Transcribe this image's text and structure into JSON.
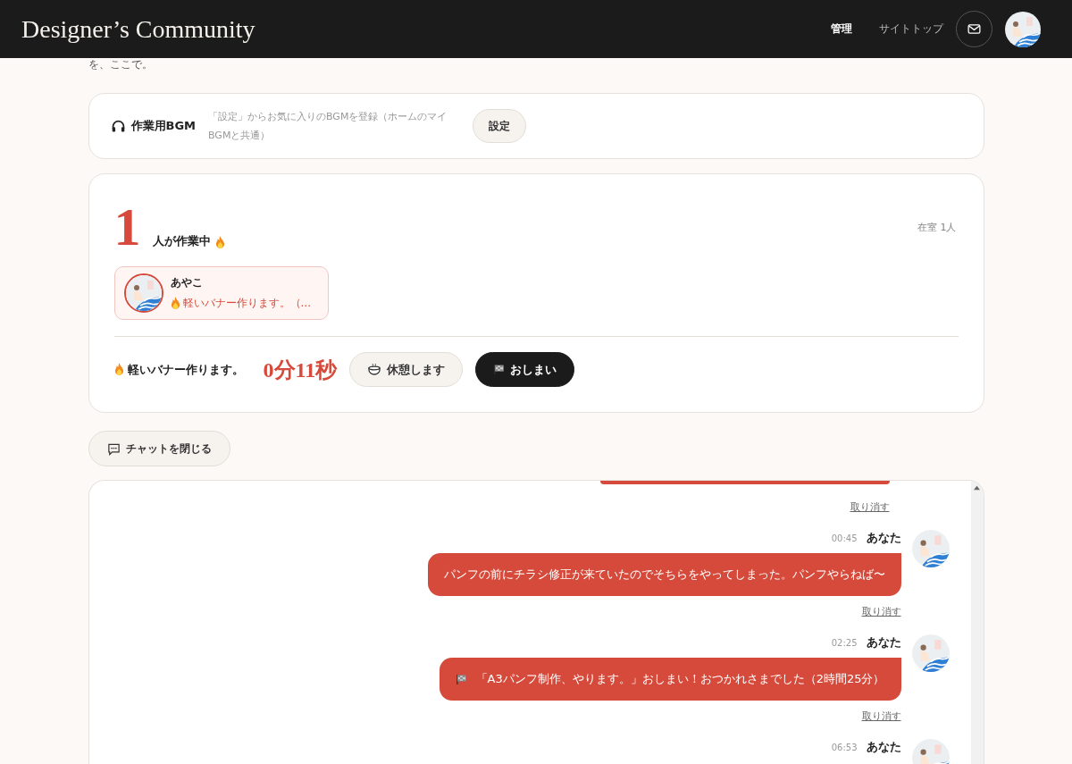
{
  "header": {
    "title": "Designer’s Community",
    "nav": [
      {
        "label": "管理",
        "selected": true
      },
      {
        "label": "サイトトップ",
        "selected": false
      }
    ]
  },
  "intro_tail": "を、ここで。",
  "bgm": {
    "title": "作業用BGM",
    "hint": "「設定」からお気に入りのBGMを登録（ホームのマイBGMと共通）",
    "button": "設定"
  },
  "work": {
    "count": "1",
    "count_label": "人が作業中",
    "room": "在室 1人",
    "members": [
      {
        "name": "あやこ",
        "status": "軽いバナー作ります。（..."
      }
    ],
    "my_task": "軽いバナー作ります。",
    "timer": "0分11秒",
    "break_button": "休憩します",
    "finish_button": "おしまい"
  },
  "chat_toggle": "チャットを閉じる",
  "messages": [
    {
      "kind": "clipped",
      "undo": "取り消す"
    },
    {
      "kind": "text",
      "time": "00:45",
      "author": "あなた",
      "text": "パンフの前にチラシ修正が来ていたのでそちらをやってしまった。パンフやらねば〜",
      "undo": "取り消す"
    },
    {
      "kind": "finish",
      "time": "02:25",
      "author": "あなた",
      "text": "「A3パンフ制作、やります。」おしまい！おつかれさまでした（2時間25分）",
      "undo": "取り消す"
    },
    {
      "kind": "header_only",
      "time": "06:53",
      "author": "あなた"
    }
  ]
}
